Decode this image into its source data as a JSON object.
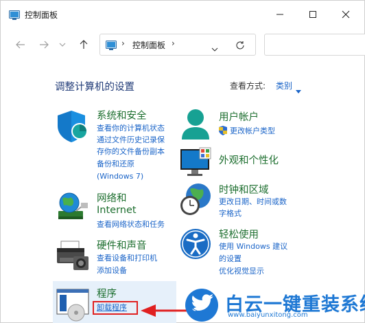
{
  "window": {
    "title": "控制面板"
  },
  "address": {
    "path": "控制面板",
    "separator": "›"
  },
  "header": {
    "title": "调整计算机的设置",
    "view_by_label": "查看方式:",
    "view_by_value": "类别"
  },
  "categories": [
    {
      "title": "系统和安全",
      "links": [
        "查看你的计算机状态",
        "通过文件历史记录保",
        "存你的文件备份副本",
        "备份和还原",
        "(Windows 7)"
      ]
    },
    {
      "title": "网络和",
      "title2": "Internet",
      "links": [
        "查看网络状态和任务"
      ]
    },
    {
      "title": "硬件和声音",
      "links": [
        "查看设备和打印机",
        "添加设备"
      ]
    },
    {
      "title": "程序",
      "links": [
        "卸载程序"
      ]
    },
    {
      "title": "用户帐户",
      "links": [
        "更改帐户类型"
      ]
    },
    {
      "title": "外观和个性化",
      "links": []
    },
    {
      "title": "时钟和区域",
      "links": [
        "更改日期、时间或数",
        "字格式"
      ]
    },
    {
      "title": "轻松使用",
      "links": [
        "使用 Windows 建议",
        "的设置",
        "优化视觉显示"
      ]
    }
  ],
  "watermark": {
    "title": "白云一键重装系统",
    "url": "www.baiyunxitong.com"
  },
  "colors": {
    "category_title": "#1c6e2e",
    "link": "#1a64c8",
    "page_title": "#1f3a77",
    "highlight": "#e02020",
    "watermark": "#1e78d4"
  },
  "icons": {
    "system-security": "shield-icon",
    "network": "globe-network-icon",
    "hardware": "printer-icon",
    "programs": "programs-icon",
    "user-accounts": "user-icon",
    "appearance": "monitor-icon",
    "clock": "clock-globe-icon",
    "ease-of-access": "accessibility-icon"
  }
}
